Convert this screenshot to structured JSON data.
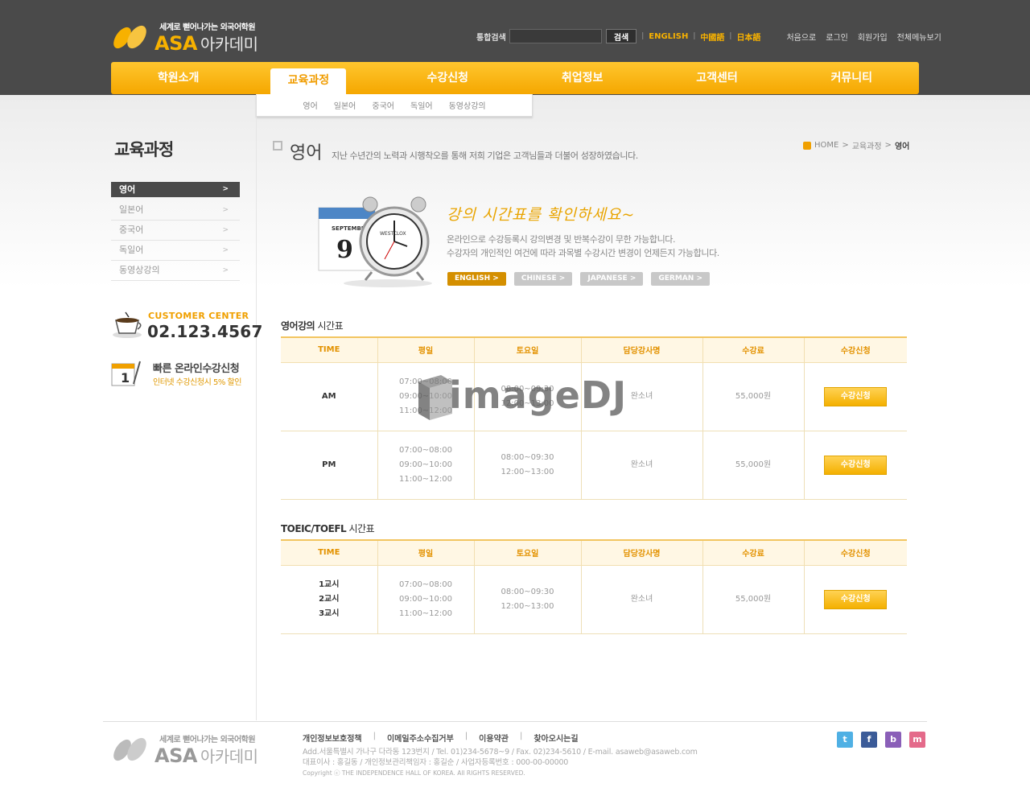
{
  "header": {
    "logo_tagline": "세계로 뻗어나가는 외국어학원",
    "logo_brand": "ASA",
    "logo_brand_sub": "아카데미",
    "search_label": "통합검색",
    "search_placeholder": "",
    "search_button": "검색",
    "languages": [
      "ENGLISH",
      "中國語",
      "日本語"
    ],
    "util_links": [
      "처음으로",
      "로그인",
      "회원가입",
      "전체메뉴보기"
    ]
  },
  "gnb": {
    "items": [
      "학원소개",
      "교육과정",
      "수강신청",
      "취업정보",
      "고객센터",
      "커뮤니티"
    ],
    "active": "교육과정"
  },
  "submenu": [
    "영어",
    "일본어",
    "중국어",
    "독일어",
    "동영상강의"
  ],
  "sidebar": {
    "title": "교육과정",
    "items": [
      "영어",
      "일본어",
      "중국어",
      "독일어",
      "동영상강의"
    ],
    "active": "영어",
    "customer_center_label": "CUSTOMER CENTER",
    "customer_center_phone": "02.123.4567",
    "online_title": "빠른 온라인수강신청",
    "online_sub": "인터넷 수강신청시 5% 할인"
  },
  "content": {
    "title": "영어",
    "description": "지난 수년간의 노력과 시행착오를 통해 저희 기업은 고객님들과 더불어 성장하였습니다.",
    "breadcrumb": [
      "HOME",
      "교육과정",
      "영어"
    ],
    "banner": {
      "script_title": "강의 시간표를 확인하세요~",
      "line1": "온라인으로 수강등록시 강의변경 및 반복수강이 무한 가능합니다.",
      "line2": "수강자의 개인적인 여건에 따라 과목별 수강시간 변경이 언제든지 가능합니다.",
      "calendar_month": "SEPTEMBER",
      "calendar_day": "9",
      "clock_brand": "WESTCLOX",
      "lang_tabs": [
        "ENGLISH",
        "CHINESE",
        "JAPANESE",
        "GERMAN"
      ],
      "active_tab": "ENGLISH"
    }
  },
  "table1": {
    "title_bold": "영어강의",
    "title_rest": " 시간표",
    "headers": [
      "TIME",
      "평일",
      "토요일",
      "담당강사명",
      "수강료",
      "수강신청"
    ],
    "rows": [
      {
        "time": "AM",
        "weekday": [
          "07:00~08:00",
          "09:00~10:00",
          "11:00~12:00"
        ],
        "saturday": [
          "08:00~09:30",
          "12:00~13:00"
        ],
        "teacher": "완소녀",
        "fee": "55,000원",
        "apply": "수강신청"
      },
      {
        "time": "PM",
        "weekday": [
          "07:00~08:00",
          "09:00~10:00",
          "11:00~12:00"
        ],
        "saturday": [
          "08:00~09:30",
          "12:00~13:00"
        ],
        "teacher": "완소녀",
        "fee": "55,000원",
        "apply": "수강신청"
      }
    ]
  },
  "table2": {
    "title_bold": "TOEIC/TOEFL",
    "title_rest": " 시간표",
    "headers": [
      "TIME",
      "평일",
      "토요일",
      "담당강사명",
      "수강료",
      "수강신청"
    ],
    "rows": [
      {
        "time": [
          "1교시",
          "2교시",
          "3교시"
        ],
        "weekday": [
          "07:00~08:00",
          "09:00~10:00",
          "11:00~12:00"
        ],
        "saturday": [
          "08:00~09:30",
          "12:00~13:00"
        ],
        "teacher": "완소녀",
        "fee": "55,000원",
        "apply": "수강신청"
      }
    ]
  },
  "watermark": "imageDJ",
  "footer": {
    "logo_tagline": "세계로 뻗어나가는 외국어학원",
    "logo_brand": "ASA",
    "logo_brand_sub": "아카데미",
    "links": [
      "개인정보보호정책",
      "이메일주소수집거부",
      "이용약관",
      "찾아오시는길"
    ],
    "address": "Add.서울특별시 가나구 다라동 123번지  / Tel. 01)234-5678~9  / Fax. 02)234-5610  / E-mail. asaweb@asaweb.com",
    "info": "대표이사 : 홍길동 / 개인정보관리책임자 : 홍길순 / 사업자등록번호 : 000-00-00000",
    "copyright": "Copyright ⓒ THE INDEPENDENCE HALL OF KOREA. All RIGHTS RESERVED.",
    "social": [
      "twitter-icon",
      "facebook-icon",
      "blog-icon",
      "me2day-icon"
    ]
  },
  "colors": {
    "accent": "#f5a700",
    "dark": "#4a4a4a"
  }
}
